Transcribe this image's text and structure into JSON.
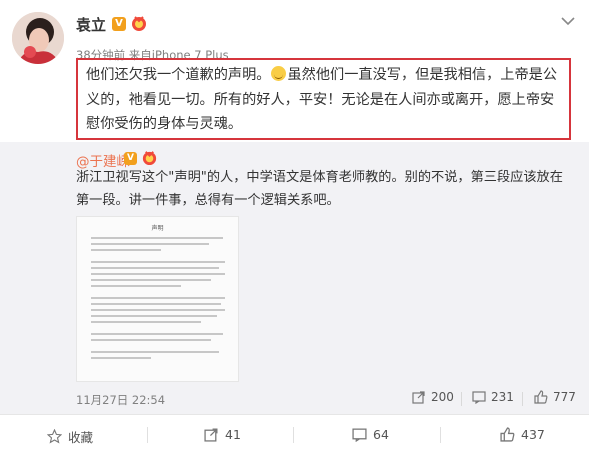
{
  "post": {
    "author": "袁立",
    "verified_badge": "V",
    "meta": {
      "time": "38分钟前",
      "source_prefix": "来自",
      "source": "iPhone 7 Plus"
    },
    "text_before_emoji": "他们还欠我一个道歉的声明。",
    "emoji": "smile-emoji",
    "text_after_emoji": "虽然他们一直没写，但是我相信，上帝是公义的，祂看见一切。所有的好人，平安！无论是在人间亦或离开，愿上帝安慰你受伤的身体与灵魂。"
  },
  "repost": {
    "author": "@于建嵘",
    "verified_badge": "V",
    "text": "浙江卫视写这个\"声明\"的人，中学语文是体育老师教的。别的不说，第三段应该放在第一段。讲一件事，总得有一个逻辑关系吧。",
    "image_title": "声明",
    "date": "11月27日 22:54",
    "stats": {
      "forward": "200",
      "comment": "231",
      "like": "777"
    }
  },
  "actions": {
    "favorite": "收藏",
    "forward": "41",
    "comment": "64",
    "like": "437"
  },
  "colors": {
    "accent": "#eb7350",
    "highlight_border": "#d6353c",
    "badge": "#f2a01d"
  }
}
